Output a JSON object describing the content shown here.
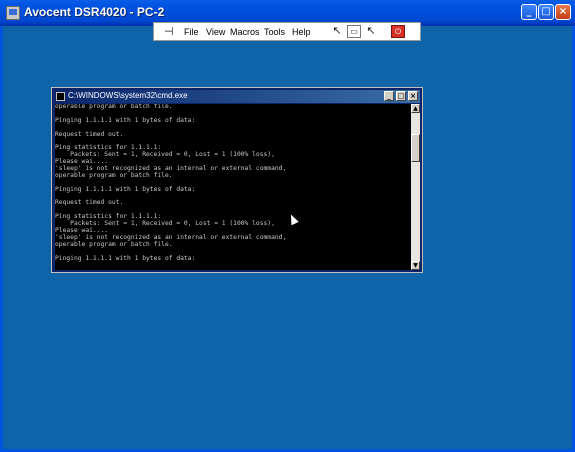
{
  "outer_window": {
    "title": "Avocent DSR4020 - PC-2",
    "buttons": {
      "minimize": "_",
      "maximize": "□",
      "close": "×"
    }
  },
  "kvm_toolbar": {
    "menus": [
      "File",
      "View",
      "Macros",
      "Tools",
      "Help"
    ]
  },
  "cmd_window": {
    "title": "C:\\WINDOWS\\system32\\cmd.exe",
    "buttons": {
      "minimize": "_",
      "maximize": "□",
      "close": "×"
    },
    "lines": [
      "operable program or batch file.",
      "",
      "Pinging 1.1.1.1 with 1 bytes of data:",
      "",
      "Request timed out.",
      "",
      "Ping statistics for 1.1.1.1:",
      "    Packets: Sent = 1, Received = 0, Lost = 1 (100% loss),",
      "Please wai....",
      "'sleep' is not recognized as an internal or external command,",
      "operable program or batch file.",
      "",
      "Pinging 1.1.1.1 with 1 bytes of data:",
      "",
      "Request timed out.",
      "",
      "Ping statistics for 1.1.1.1:",
      "    Packets: Sent = 1, Received = 0, Lost = 1 (100% loss),",
      "Please wai....",
      "'sleep' is not recognized as an internal or external command,",
      "operable program or batch file.",
      "",
      "Pinging 1.1.1.1 with 1 bytes of data:"
    ]
  }
}
